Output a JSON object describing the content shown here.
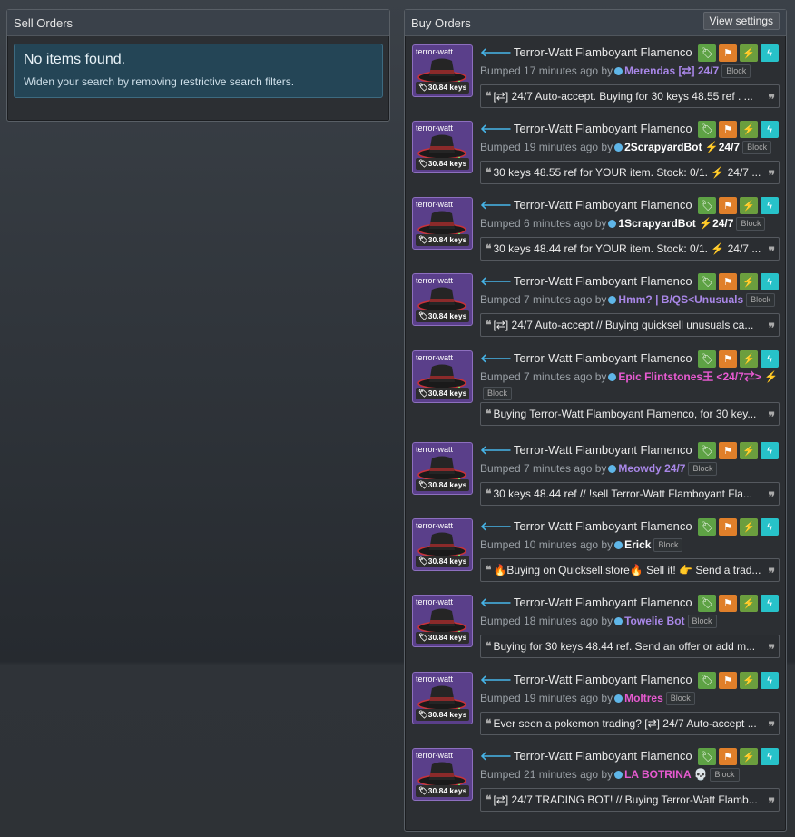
{
  "sell_orders": {
    "title": "Sell Orders",
    "empty_title": "No items found.",
    "empty_sub": "Widen your search by removing restrictive search filters."
  },
  "buy_orders": {
    "title": "Buy Orders",
    "view_settings": "View settings",
    "listings": [
      {
        "item": "Terror-Watt Flamboyant Flamenco",
        "thumb_label": "terror-watt",
        "price": "30.84 keys",
        "bumped": "Bumped 17 minutes ago by",
        "user": "Merendas [⇄] 24/7",
        "user_color": "#a987e8",
        "bolt": false,
        "block": "Block",
        "quote": "[⇄] 24/7 Auto-accept. Buying for 30 keys 48.55 ref . ..."
      },
      {
        "item": "Terror-Watt Flamboyant Flamenco",
        "thumb_label": "terror-watt",
        "price": "30.84 keys",
        "bumped": "Bumped 19 minutes ago by",
        "user": "2ScrapyardBot",
        "user_suffix": "24/7",
        "user_color": "#ffffff",
        "bolt": true,
        "block": "Block",
        "quote": "30 keys 48.55 ref for YOUR item. Stock: 0/1. ⚡ 24/7 ..."
      },
      {
        "item": "Terror-Watt Flamboyant Flamenco",
        "thumb_label": "terror-watt",
        "price": "30.84 keys",
        "bumped": "Bumped 6 minutes ago by",
        "user": "1ScrapyardBot",
        "user_suffix": "24/7",
        "user_color": "#ffffff",
        "bolt": true,
        "block": "Block",
        "quote": "30 keys 48.44 ref for YOUR item. Stock: 0/1. ⚡ 24/7 ..."
      },
      {
        "item": "Terror-Watt Flamboyant Flamenco",
        "thumb_label": "terror-watt",
        "price": "30.84 keys",
        "bumped": "Bumped 7 minutes ago by",
        "user": "Hmm? | B/QS<Unusuals",
        "user_color": "#a987e8",
        "bolt": false,
        "block": "Block",
        "quote": "[⇄] 24/7 Auto-accept // Buying quicksell unusuals ca..."
      },
      {
        "item": "Terror-Watt Flamboyant Flamenco",
        "thumb_label": "terror-watt",
        "price": "30.84 keys",
        "bumped": "Bumped 7 minutes ago by",
        "user": "Epic Flintstones王 <24/7⇄>",
        "user_color": "#e85ad1",
        "bolt": true,
        "block": "Block",
        "quote": "Buying Terror-Watt Flamboyant Flamenco, for 30 key..."
      },
      {
        "item": "Terror-Watt Flamboyant Flamenco",
        "thumb_label": "terror-watt",
        "price": "30.84 keys",
        "bumped": "Bumped 7 minutes ago by",
        "user": "Meowdy 24/7",
        "user_color": "#a987e8",
        "bolt": false,
        "block": "Block",
        "quote": "30 keys 48.44 ref // !sell Terror-Watt Flamboyant Fla..."
      },
      {
        "item": "Terror-Watt Flamboyant Flamenco",
        "thumb_label": "terror-watt",
        "price": "30.84 keys",
        "bumped": "Bumped 10 minutes ago by",
        "user": "Erick",
        "user_color": "#ffffff",
        "bolt": false,
        "block": "Block",
        "quote": "🔥Buying on Quicksell.store🔥 Sell it! 👉 Send a trad..."
      },
      {
        "item": "Terror-Watt Flamboyant Flamenco",
        "thumb_label": "terror-watt",
        "price": "30.84 keys",
        "bumped": "Bumped 18 minutes ago by",
        "user": "Towelie Bot",
        "user_color": "#a987e8",
        "bolt": false,
        "block": "Block",
        "quote": "Buying for 30 keys 48.44 ref. Send an offer or add m..."
      },
      {
        "item": "Terror-Watt Flamboyant Flamenco",
        "thumb_label": "terror-watt",
        "price": "30.84 keys",
        "bumped": "Bumped 19 minutes ago by",
        "user": "Moltres",
        "user_color": "#e85ad1",
        "bolt": false,
        "block": "Block",
        "quote": "Ever seen a pokemon trading? [⇄] 24/7 Auto-accept ..."
      },
      {
        "item": "Terror-Watt Flamboyant Flamenco",
        "thumb_label": "terror-watt",
        "price": "30.84 keys",
        "bumped": "Bumped 21 minutes ago by",
        "user": "LA BOTRINA 💀",
        "user_color": "#e85ad1",
        "bolt": false,
        "block": "Block",
        "quote": "[⇄] 24/7 TRADING BOT! // Buying Terror-Watt Flamb..."
      }
    ]
  },
  "colors": {
    "tag_btn": "#5ea245",
    "flag_btn": "#e07f2a",
    "bolt_btn": "#6b9e3e",
    "instant_btn": "#27c2c9",
    "accent": "#46b3e6"
  },
  "icons": [
    "tag-icon",
    "flag-icon",
    "lightning-icon",
    "instant-icon",
    "quote-open-icon",
    "quote-close-icon",
    "left-arrow-icon"
  ]
}
